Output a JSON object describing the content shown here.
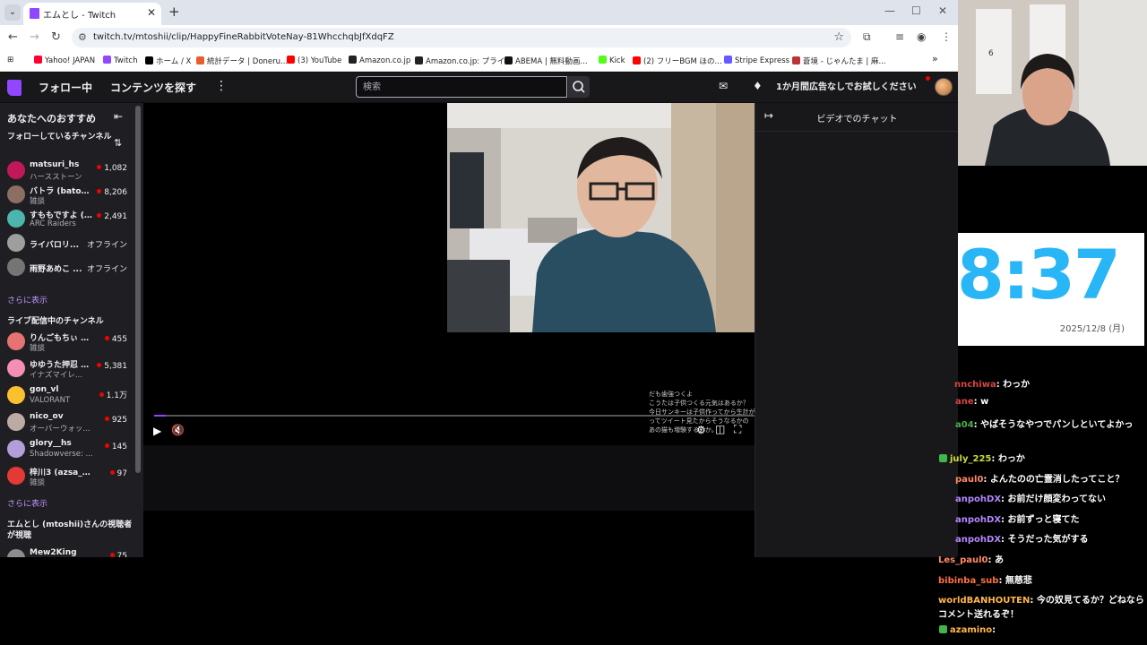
{
  "browser": {
    "tab_title": "エムとし - Twitch",
    "url": "twitch.tv/mtoshii/clip/HappyFineRabbitVoteNay-81WhcchqbJfXdqFZ",
    "bookmarks": [
      {
        "label": "Yahoo! JAPAN",
        "color": "#ff0033"
      },
      {
        "label": "Twitch",
        "color": "#9146ff"
      },
      {
        "label": "ホーム / X",
        "color": "#000000"
      },
      {
        "label": "統計データ | Doneru...",
        "color": "#e85d2f"
      },
      {
        "label": "(3) YouTube",
        "color": "#ff0000"
      },
      {
        "label": "Amazon.co.jp",
        "color": "#222222"
      },
      {
        "label": "Amazon.co.jp: プライ...",
        "color": "#222222"
      },
      {
        "label": "ABEMA | 無料動画...",
        "color": "#111111"
      },
      {
        "label": "Kick",
        "color": "#53fc18"
      },
      {
        "label": "(2) フリーBGM ほの...",
        "color": "#ff0000"
      },
      {
        "label": "Stripe Express",
        "color": "#635bff"
      },
      {
        "label": "蒼境 - じゃんたま | 麻...",
        "color": "#b33"
      }
    ],
    "more_bookmarks": "»"
  },
  "twitch_nav": {
    "following": "フォロー中",
    "browse": "コンテンツを探す",
    "more": "⋮",
    "search_placeholder": "検索",
    "ad_free": "1か月間広告なしでお試しください"
  },
  "sidebar": {
    "title": "あなたへのおすすめ",
    "followed_header": "フォローしているチャンネル",
    "followed": [
      {
        "name": "matsuri_hs",
        "game": "ハースストーン",
        "viewers": "1,082",
        "color": "#c2185b"
      },
      {
        "name": "バトラ (batora...",
        "game": "雑談",
        "viewers": "8,206",
        "color": "#8d6e63"
      },
      {
        "name": "すももですよ (...",
        "game": "ARC Raiders",
        "viewers": "2,491",
        "color": "#4db6ac"
      },
      {
        "name": "ライバロリ...",
        "status": "オフライン",
        "color": "#9e9e9e"
      },
      {
        "name": "雨野あめこ ...",
        "status": "オフライン",
        "color": "#757575"
      }
    ],
    "show_more_1": "さらに表示",
    "live_header": "ライブ配信中のチャンネル",
    "live": [
      {
        "name": "りんごもちぃ (m...",
        "game": "雑談",
        "viewers": "455",
        "color": "#e57373"
      },
      {
        "name": "ゆゆうた押忍 (...",
        "game": "イナズマイレ...",
        "viewers": "5,381",
        "color": "#f48fb1"
      },
      {
        "name": "gon_vl",
        "game": "VALORANT",
        "viewers": "1.1万",
        "color": "#fbc02d"
      },
      {
        "name": "nico_ov",
        "game": "オーバーウォッ...",
        "viewers": "925",
        "color": "#bcaaa4"
      },
      {
        "name": "glory__hs",
        "game": "Shadowverse: ...",
        "viewers": "145",
        "color": "#b39ddb"
      },
      {
        "name": "梓川3 (azsa_397)",
        "game": "雑談",
        "viewers": "97",
        "color": "#e53935"
      }
    ],
    "show_more_2": "さらに表示",
    "viewers_header": "エムとし (mtoshii)さんの視聴者が視聴",
    "partial": {
      "name": "Mew2King",
      "viewers": "75"
    }
  },
  "player": {
    "progress": 0.02,
    "overlay_lines": [
      "だも歯強つくよ",
      "こうたは子供つくる元気はあるか？",
      "今日サンキーは子供作ってから生計が",
      "ってツイート見たからそうなるかの",
      "あの猫も増験するのか。"
    ]
  },
  "video_chat": {
    "title": "ビデオでのチャット"
  },
  "stream_overlay": {
    "clock_time": ".8:37",
    "clock_date": "2025/12/8 (月)",
    "chat": [
      {
        "user": "nnchiwa",
        "msg": ": わっか",
        "color": "#d64545"
      },
      {
        "user": "ane",
        "msg": ": w",
        "color": "#d64545"
      },
      {
        "user": "a04",
        "msg": ": やばそうなやつでパンしといてよかっ",
        "color": "#4caf50"
      },
      {
        "user": "july_225",
        "msg": ": わっか",
        "color": "#cddc39"
      },
      {
        "user": "paul0",
        "msg": ": よんたのの亡霊消したってこと？",
        "color": "#ff8a65"
      },
      {
        "user": "anpohDX",
        "msg": ": お前だけ顔変わってない",
        "color": "#b388ff"
      },
      {
        "user": "anpohDX",
        "msg": ": お前ずっと寝てた",
        "color": "#b388ff"
      },
      {
        "user": "anpohDX",
        "msg": ": そうだった気がする",
        "color": "#b388ff"
      },
      {
        "user": "Les_paul0",
        "msg": ": あ",
        "color": "#ff8a65"
      },
      {
        "user": "bibinba_sub",
        "msg": ": 無慈悲",
        "color": "#ff7043"
      },
      {
        "user": "worldBANHOUTEN",
        "msg": ": 今の奴見てるか？どねなら",
        "color": "#ffb74d"
      },
      {
        "user": "",
        "msg": "コメント送れるぞ！",
        "color": "#ffffff"
      },
      {
        "user": "azamino",
        "msg": ":",
        "color": "#ffb74d"
      }
    ]
  }
}
